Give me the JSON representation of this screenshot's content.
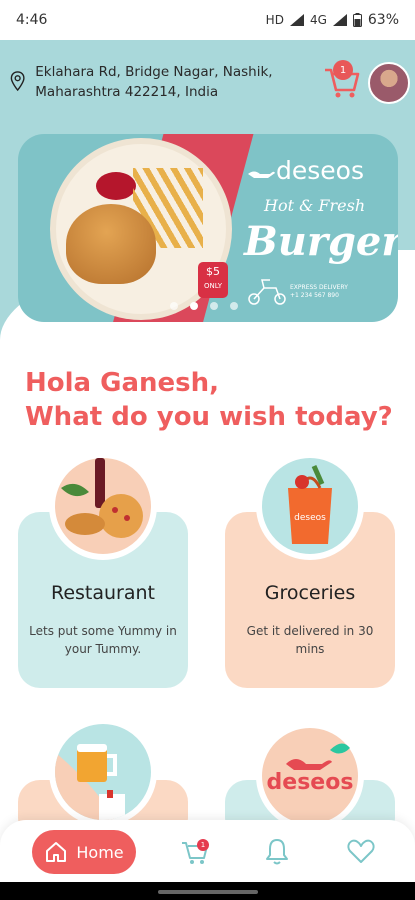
{
  "status": {
    "time": "4:46",
    "network": "HD",
    "signal": "4G",
    "battery": "63%"
  },
  "location": {
    "address": "Eklahara Rd, Bridge Nagar, Nashik, Maharashtra 422214, India"
  },
  "cart": {
    "count": "1"
  },
  "banner": {
    "brand": "deseos",
    "tagline": "Hot & Fresh",
    "headline": "Burger",
    "price": "$5",
    "price_unit": "ONLY",
    "delivery_label": "EXPRESS DELIVERY",
    "delivery_phone": "+1 234 567 890",
    "active_slide": 1
  },
  "greeting": {
    "line1": "Hola Ganesh,",
    "line2": "What do you wish today?"
  },
  "categories": [
    {
      "title": "Restaurant",
      "desc": "Lets put some Yummy in your Tummy."
    },
    {
      "title": "Groceries",
      "desc": "Get it delivered in 30 mins"
    }
  ],
  "partial": {
    "brand_word": "deseos"
  },
  "nav": {
    "home_label": "Home",
    "cart_badge": "1"
  },
  "colors": {
    "accent": "#ef5e5e",
    "teal": "#a9d8da",
    "peach": "#fbd9c4"
  }
}
